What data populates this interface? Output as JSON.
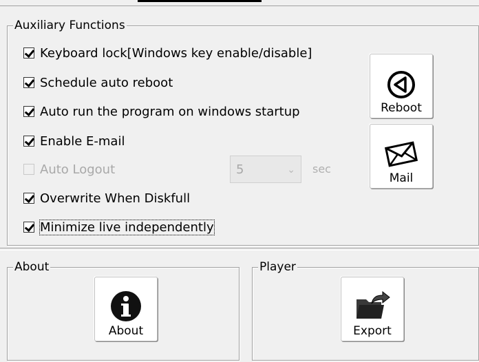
{
  "aux": {
    "title": "Auxiliary Functions",
    "options": [
      {
        "label": "Keyboard lock[Windows key enable/disable]",
        "checked": true,
        "disabled": false
      },
      {
        "label": "Schedule auto reboot",
        "checked": true,
        "disabled": false
      },
      {
        "label": "Auto run the program on windows startup",
        "checked": true,
        "disabled": false
      },
      {
        "label": "Enable E-mail",
        "checked": true,
        "disabled": false
      },
      {
        "label": "Auto Logout",
        "checked": false,
        "disabled": true
      },
      {
        "label": "Overwrite When Diskfull",
        "checked": true,
        "disabled": false
      },
      {
        "label": "Minimize live independently",
        "checked": true,
        "disabled": false
      }
    ],
    "logout_select_value": "5",
    "logout_unit": "sec",
    "reboot_label": "Reboot",
    "mail_label": "Mail"
  },
  "about": {
    "title": "About",
    "button_label": "About"
  },
  "player": {
    "title": "Player",
    "button_label": "Export"
  },
  "icons": {
    "reboot": "reboot-icon",
    "mail": "mail-icon",
    "about": "info-icon",
    "export": "export-icon"
  }
}
